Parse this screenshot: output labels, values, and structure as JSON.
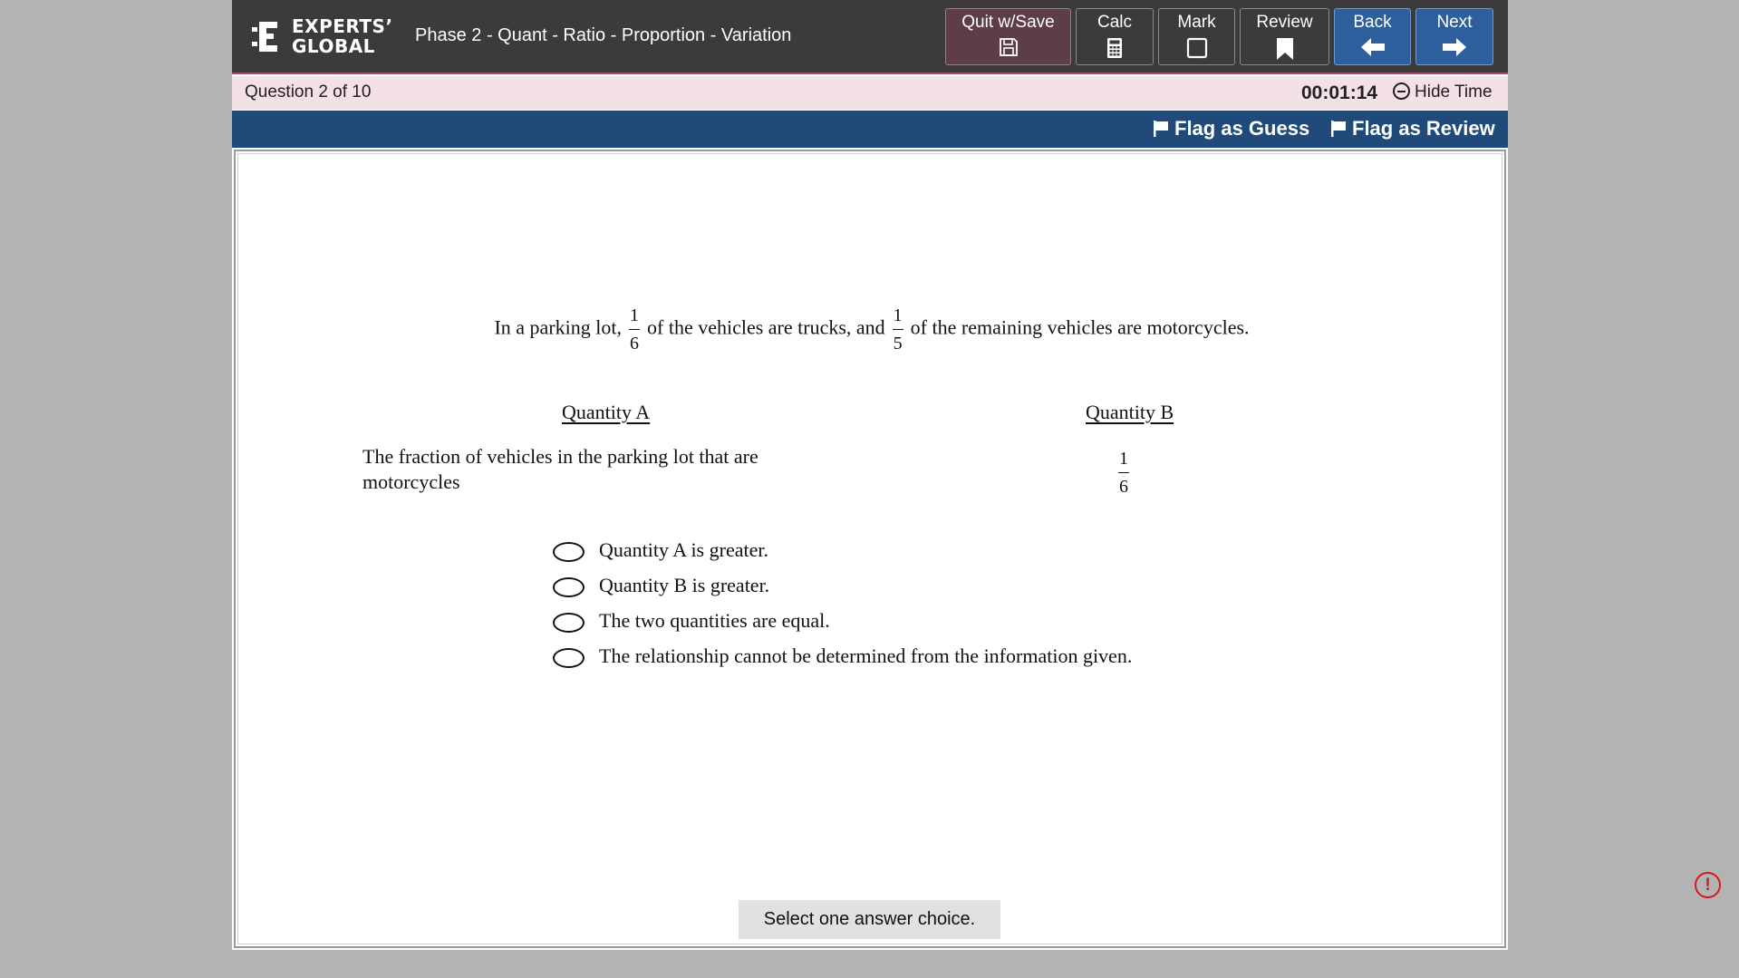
{
  "header": {
    "logo_line1": "EXPERTS’",
    "logo_line2": "GLOBAL",
    "title": "Phase 2 - Quant - Ratio - Proportion - Variation",
    "buttons": {
      "quit": "Quit w/Save",
      "calc": "Calc",
      "mark": "Mark",
      "review": "Review",
      "back": "Back",
      "next": "Next"
    }
  },
  "status": {
    "question_counter": "Question 2 of 10",
    "timer": "00:01:14",
    "hide_time": "Hide Time"
  },
  "flags": {
    "guess": "Flag as Guess",
    "review": "Flag as Review"
  },
  "question": {
    "stem_part1": "In a parking lot,",
    "frac1_num": "1",
    "frac1_den": "6",
    "stem_part2": "of the vehicles are trucks, and",
    "frac2_num": "1",
    "frac2_den": "5",
    "stem_part3": "of the remaining vehicles are motorcycles.",
    "quantity_a_label": "Quantity A",
    "quantity_b_label": "Quantity B",
    "quantity_a_text": "The fraction of vehicles in the parking lot that are motorcycles",
    "quantity_b_num": "1",
    "quantity_b_den": "6",
    "choices": [
      "Quantity A is greater.",
      "Quantity B is greater.",
      "The two quantities are equal.",
      "The relationship cannot be determined from the information given."
    ],
    "instruction": "Select one answer choice."
  },
  "colors": {
    "header_bg": "#3c3a3b",
    "status_bg": "#f3e1e5",
    "flagbar_bg": "#1f4a7a",
    "nav_button_bg": "#2e5f9d",
    "quit_button_bg": "#5e3d4a",
    "alert": "#d01b1b"
  },
  "icons": {
    "quit": "save-disk-icon",
    "calc": "calculator-icon",
    "mark": "checkbox-square-icon",
    "review": "bookmark-icon",
    "back": "arrow-left-icon",
    "next": "arrow-right-icon",
    "flag": "flag-icon",
    "hide_time": "minus-circle-icon",
    "alert": "exclamation-circle-icon"
  }
}
